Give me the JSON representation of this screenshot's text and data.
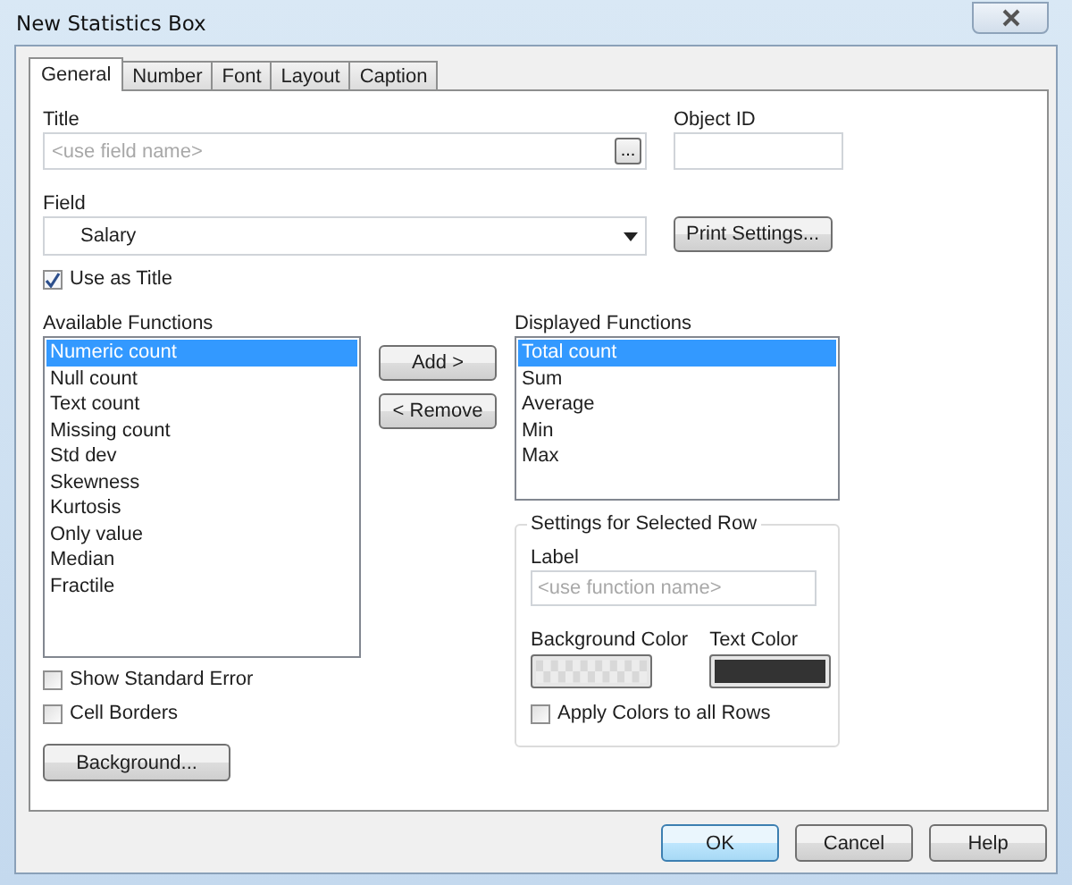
{
  "window": {
    "title": "New Statistics Box"
  },
  "tabs": [
    {
      "label": "General",
      "selected": true
    },
    {
      "label": "Number",
      "selected": false
    },
    {
      "label": "Font",
      "selected": false
    },
    {
      "label": "Layout",
      "selected": false
    },
    {
      "label": "Caption",
      "selected": false
    }
  ],
  "title_field": {
    "label": "Title",
    "placeholder": "<use field name>",
    "browse_button": "..."
  },
  "object_id": {
    "label": "Object ID"
  },
  "field": {
    "label": "Field",
    "value": "Salary"
  },
  "print_settings_button": "Print Settings...",
  "use_as_title": {
    "label": "Use as Title",
    "checked": true
  },
  "available_functions": {
    "label": "Available Functions",
    "items": [
      {
        "label": "Numeric count",
        "selected": true
      },
      {
        "label": "Null count",
        "selected": false
      },
      {
        "label": "Text count",
        "selected": false
      },
      {
        "label": "Missing count",
        "selected": false
      },
      {
        "label": "Std dev",
        "selected": false
      },
      {
        "label": "Skewness",
        "selected": false
      },
      {
        "label": "Kurtosis",
        "selected": false
      },
      {
        "label": "Only value",
        "selected": false
      },
      {
        "label": "Median",
        "selected": false
      },
      {
        "label": "Fractile",
        "selected": false
      }
    ]
  },
  "move_buttons": [
    "Add >",
    "< Remove"
  ],
  "displayed_functions": {
    "label": "Displayed Functions",
    "items": [
      {
        "label": "Total count",
        "selected": true
      },
      {
        "label": "Sum",
        "selected": false
      },
      {
        "label": "Average",
        "selected": false
      },
      {
        "label": "Min",
        "selected": false
      },
      {
        "label": "Max",
        "selected": false
      }
    ]
  },
  "row_settings": {
    "title": "Settings for Selected Row",
    "label_field": {
      "label": "Label",
      "placeholder": "<use function name>"
    },
    "background_color": {
      "label": "Background Color"
    },
    "text_color": {
      "label": "Text Color",
      "color": "#333333"
    },
    "apply_all": {
      "label": "Apply Colors to all Rows",
      "checked": false
    }
  },
  "options": [
    {
      "label": "Show Standard Error",
      "checked": false
    },
    {
      "label": "Cell Borders",
      "checked": false
    }
  ],
  "background_button": "Background...",
  "dialog_buttons": [
    {
      "label": "OK",
      "selected": true
    },
    {
      "label": "Cancel",
      "selected": false
    },
    {
      "label": "Help",
      "selected": false
    }
  ]
}
